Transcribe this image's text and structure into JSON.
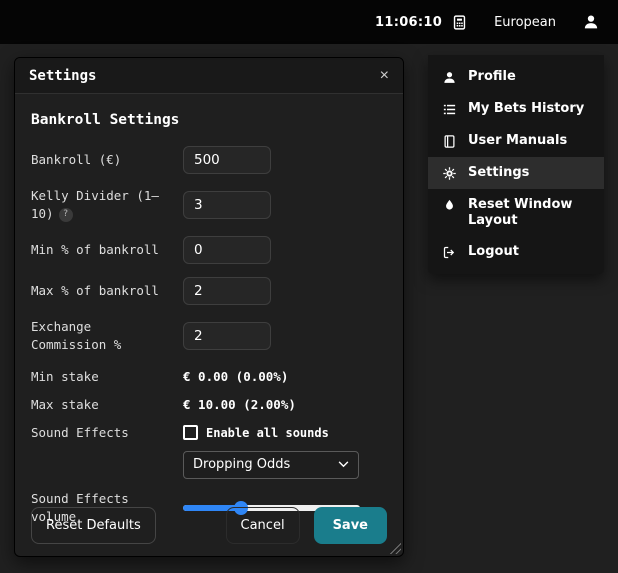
{
  "colors": {
    "topbar_bg": "#050505",
    "page_bg": "#202020",
    "modal_bg": "#1f1f1f",
    "accent_save": "#1a7d8c",
    "slider_blue": "#2f86f6",
    "menu_bg": "#151515",
    "menu_active_bg": "#2d2d2d"
  },
  "topbar": {
    "time": "11:06:10",
    "odds_format": "European"
  },
  "modal": {
    "title": "Settings",
    "close_label": "×",
    "section_title": "Bankroll Settings",
    "bankroll": {
      "label": "Bankroll (€)",
      "value": "500"
    },
    "kelly": {
      "label": "Kelly Divider (1–10)",
      "help": "?",
      "value": "3"
    },
    "min_pct": {
      "label": "Min % of bankroll",
      "value": "0"
    },
    "max_pct": {
      "label": "Max % of bankroll",
      "value": "2"
    },
    "commission": {
      "label": "Exchange Commission %",
      "value": "2"
    },
    "min_stake": {
      "label": "Min stake",
      "value": "€ 0.00 (0.00%)"
    },
    "max_stake": {
      "label": "Max stake",
      "value": "€ 10.00 (2.00%)"
    },
    "sound": {
      "label": "Sound Effects",
      "checkbox_label": "Enable all sounds",
      "checked": false,
      "selected_option": "Dropping Odds"
    },
    "volume": {
      "label": "Sound Effects volume",
      "percent": 33
    },
    "footer": {
      "reset": "Reset Defaults",
      "cancel": "Cancel",
      "save": "Save"
    }
  },
  "menu": {
    "items": [
      {
        "label": "Profile",
        "icon": "person-icon",
        "active": false
      },
      {
        "label": "My Bets History",
        "icon": "list-icon",
        "active": false
      },
      {
        "label": "User Manuals",
        "icon": "book-icon",
        "active": false
      },
      {
        "label": "Settings",
        "icon": "gear-icon",
        "active": true
      },
      {
        "label": "Reset Window Layout",
        "icon": "droplet-icon",
        "active": false
      },
      {
        "label": "Logout",
        "icon": "logout-icon",
        "active": false
      }
    ]
  }
}
